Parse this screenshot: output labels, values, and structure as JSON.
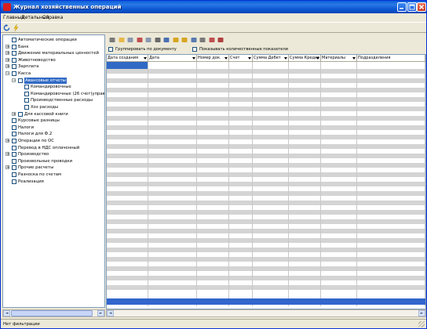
{
  "window": {
    "title": "Журнал хозяйственных операций",
    "brand_color": "#d81e1e",
    "titlebar_color": "#0a5fd8",
    "selection_color": "#316ac5"
  },
  "menu": [
    "Главный",
    "Детальный",
    "Справка"
  ],
  "top_toolbar_icons": [
    "refresh-icon",
    "lightning-icon"
  ],
  "tree": [
    {
      "label": "Автоматические операции",
      "level": 0,
      "expander": "",
      "selected": false
    },
    {
      "label": "Банк",
      "level": 0,
      "expander": "+",
      "selected": false
    },
    {
      "label": "Движение материальных ценностей",
      "level": 0,
      "expander": "+",
      "selected": false
    },
    {
      "label": "Животноводство",
      "level": 0,
      "expander": "+",
      "selected": false
    },
    {
      "label": "Зарплата",
      "level": 0,
      "expander": "+",
      "selected": false
    },
    {
      "label": "Касса",
      "level": 0,
      "expander": "-",
      "selected": false
    },
    {
      "label": "Авансовые отчеты",
      "level": 1,
      "expander": "-",
      "selected": true
    },
    {
      "label": "Командировочные",
      "level": 2,
      "expander": "",
      "selected": false
    },
    {
      "label": "Командировочные (26 счет)управлен",
      "level": 2,
      "expander": "",
      "selected": false
    },
    {
      "label": "Производственные расходы",
      "level": 2,
      "expander": "",
      "selected": false
    },
    {
      "label": "Хоз расходы",
      "level": 2,
      "expander": "",
      "selected": false
    },
    {
      "label": "Для кассовой книги",
      "level": 1,
      "expander": "+",
      "selected": false
    },
    {
      "label": "Курсовые разницы",
      "level": 0,
      "expander": "",
      "selected": false
    },
    {
      "label": "Налоги",
      "level": 0,
      "expander": "",
      "selected": false
    },
    {
      "label": "Налоги для Ф.2",
      "level": 0,
      "expander": "",
      "selected": false
    },
    {
      "label": "Операции по ОС",
      "level": 0,
      "expander": "+",
      "selected": false
    },
    {
      "label": "Перевод в НДС оплаченный",
      "level": 0,
      "expander": "",
      "selected": false
    },
    {
      "label": "Производство",
      "level": 0,
      "expander": "+",
      "selected": false
    },
    {
      "label": "Произвольные проводки",
      "level": 0,
      "expander": "",
      "selected": false
    },
    {
      "label": "Прочие расчеты",
      "level": 0,
      "expander": "+",
      "selected": false
    },
    {
      "label": "Разноска по счетам",
      "level": 0,
      "expander": "",
      "selected": false
    },
    {
      "label": "Реализация",
      "level": 0,
      "expander": "",
      "selected": false
    }
  ],
  "grid_toolbar_icons": [
    "back-arrow-icon",
    "new-folder-icon",
    "copy-icon",
    "delete-icon",
    "paste-icon",
    "print-icon",
    "save-icon",
    "lock-icon",
    "key-icon",
    "filter-icon",
    "search-icon",
    "report-icon",
    "chart-icon"
  ],
  "options": {
    "group_by_document": "Группировать по документу",
    "show_quantity": "Показывать количественные показатели"
  },
  "columns": [
    {
      "label": "Дата создания",
      "dropdown": true
    },
    {
      "label": "Дата",
      "dropdown": true
    },
    {
      "label": "Номер док.",
      "dropdown": true
    },
    {
      "label": "Счет",
      "dropdown": true
    },
    {
      "label": "Сумма Дебет",
      "dropdown": true
    },
    {
      "label": "Сумма Кредит",
      "dropdown": true
    },
    {
      "label": "Материалы",
      "dropdown": true
    },
    {
      "label": "Подразделения",
      "dropdown": false
    }
  ],
  "status": "Нет фильтрации"
}
